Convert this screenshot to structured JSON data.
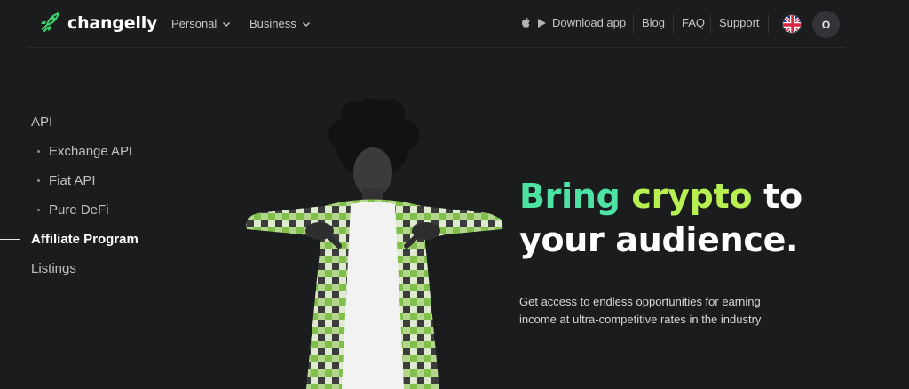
{
  "header": {
    "logo_text": "changelly",
    "nav": [
      {
        "label": "Personal"
      },
      {
        "label": "Business"
      }
    ],
    "download_app": "Download app",
    "blog": "Blog",
    "faq": "FAQ",
    "support": "Support",
    "language_flag": "uk-flag-icon",
    "account_initial": "O"
  },
  "sidebar": {
    "items": [
      {
        "label": "API",
        "level": 0,
        "active": false
      },
      {
        "label": "Exchange API",
        "level": 1,
        "active": false
      },
      {
        "label": "Fiat API",
        "level": 1,
        "active": false
      },
      {
        "label": "Pure DeFi",
        "level": 1,
        "active": false
      },
      {
        "label": "Affiliate Program",
        "level": 0,
        "active": true
      },
      {
        "label": "Listings",
        "level": 0,
        "active": false
      }
    ]
  },
  "hero": {
    "headline_word1": "Bring",
    "headline_word2": "crypto",
    "headline_word3": "to",
    "headline_line2": "your audience.",
    "description": "Get access to endless opportunities for earning income at ultra-competitive rates in the industry"
  },
  "colors": {
    "background": "#1b1c1e",
    "accent_green": "#4fe3a3",
    "accent_lime": "#b8f052"
  }
}
